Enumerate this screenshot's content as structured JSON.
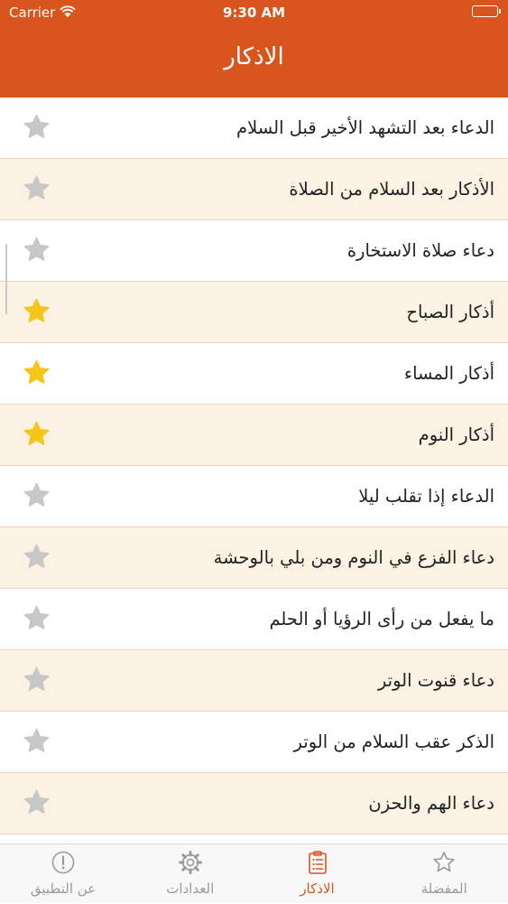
{
  "status_bar": {
    "carrier": "Carrier",
    "time": "9:30 AM"
  },
  "navigation": {
    "title": "الاذكار"
  },
  "colors": {
    "accent": "#d8561d",
    "alt_row": "#fbf2e4",
    "star_favorite": "#f5c518",
    "star_default": "#c7c7c7"
  },
  "list": {
    "items": [
      {
        "title": "الدعاء بعد التشهد الأخير قبل السلام",
        "favorite": false
      },
      {
        "title": "الأذكار بعد السلام من الصلاة",
        "favorite": false
      },
      {
        "title": "دعاء صلاة الاستخارة",
        "favorite": false
      },
      {
        "title": "أذكار الصباح",
        "favorite": true
      },
      {
        "title": "أذكار المساء",
        "favorite": true
      },
      {
        "title": "أذكار النوم",
        "favorite": true
      },
      {
        "title": "الدعاء إذا تقلب ليلا",
        "favorite": false
      },
      {
        "title": "دعاء الفزع في النوم ومن بلي بالوحشة",
        "favorite": false
      },
      {
        "title": "ما يفعل من رأى الرؤيا أو الحلم",
        "favorite": false
      },
      {
        "title": "دعاء قنوت الوتر",
        "favorite": false
      },
      {
        "title": "الذكر عقب السلام من الوتر",
        "favorite": false
      },
      {
        "title": "دعاء الهم والحزن",
        "favorite": false
      }
    ]
  },
  "tab_bar": {
    "tabs": [
      {
        "label": "المفضلة",
        "icon": "star-outline-icon",
        "active": false
      },
      {
        "label": "الاذكار",
        "icon": "clipboard-list-icon",
        "active": true
      },
      {
        "label": "العدادات",
        "icon": "gear-icon",
        "active": false
      },
      {
        "label": "عن التطبيق",
        "icon": "info-circle-icon",
        "active": false
      }
    ]
  }
}
